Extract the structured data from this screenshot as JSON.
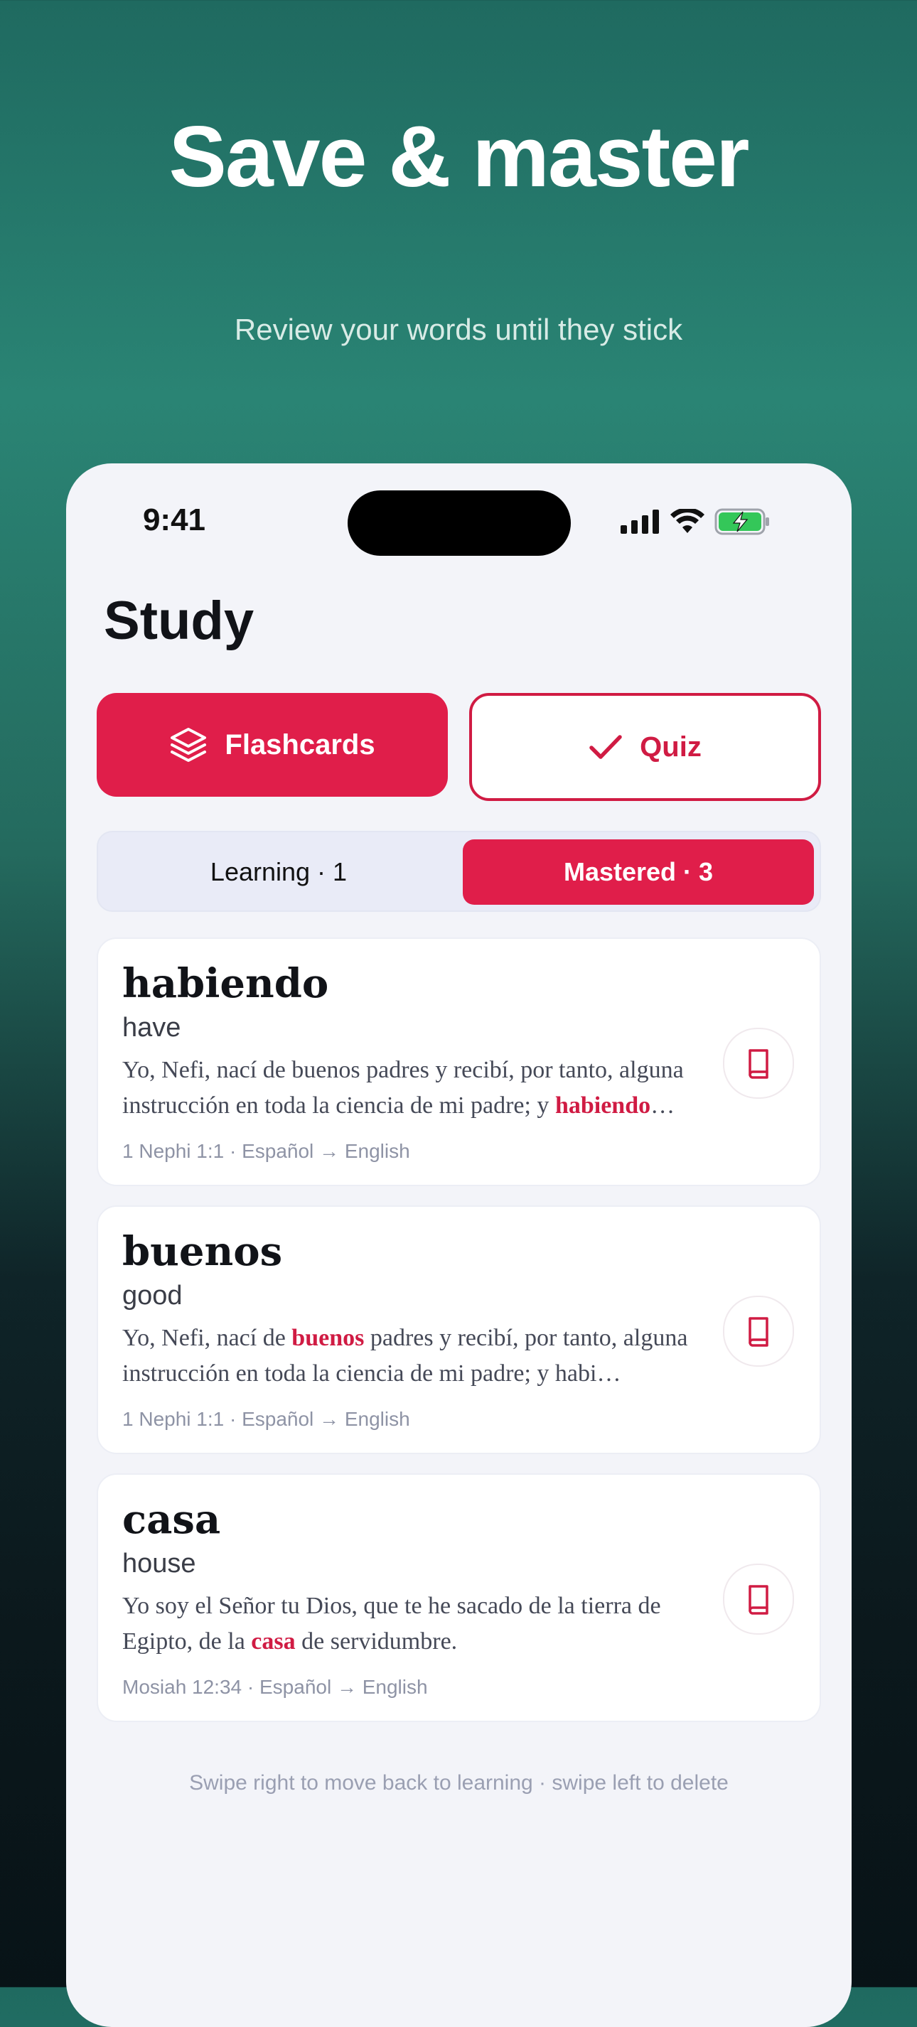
{
  "hero": {
    "title": "Save & master",
    "subtitle": "Review your words until they stick"
  },
  "status_bar": {
    "time": "9:41",
    "icons": [
      "signal-icon",
      "wifi-icon",
      "battery-charging-icon"
    ],
    "battery_color": "#34c759"
  },
  "screen": {
    "title": "Study",
    "flashcards_label": "Flashcards",
    "quiz_label": "Quiz",
    "segments": {
      "learning": "Learning · 1",
      "mastered": "Mastered · 3",
      "selected": "mastered"
    },
    "cards": [
      {
        "word": "habiendo",
        "translation": "have",
        "example_before": "Yo, Nefi, nací de buenos padres y recibí, por tanto, alguna instrucción en toda la ciencia de mi padre; y ",
        "example_highlight": "habiendo",
        "example_after": "…",
        "meta": "1 Nephi 1:1 · Español → English"
      },
      {
        "word": "buenos",
        "translation": "good",
        "example_before": "Yo, Nefi, nací de ",
        "example_highlight": "buenos",
        "example_after": " padres y recibí, por tanto, alguna instrucción en toda la ciencia de mi padre; y habi…",
        "meta": "1 Nephi 1:1 · Español → English"
      },
      {
        "word": "casa",
        "translation": "house",
        "example_before": "Yo soy el Señor tu Dios, que te he sacado de la tierra de Egipto, de la ",
        "example_highlight": "casa",
        "example_after": " de servidumbre.",
        "meta": "Mosiah 12:34 · Español → English"
      }
    ],
    "hint": "Swipe right to move back to learning · swipe left to delete"
  },
  "colors": {
    "accent": "#e01e4a",
    "background_top": "#2a8474",
    "background_bottom": "#081317",
    "screen_bg": "#f3f4f9"
  }
}
